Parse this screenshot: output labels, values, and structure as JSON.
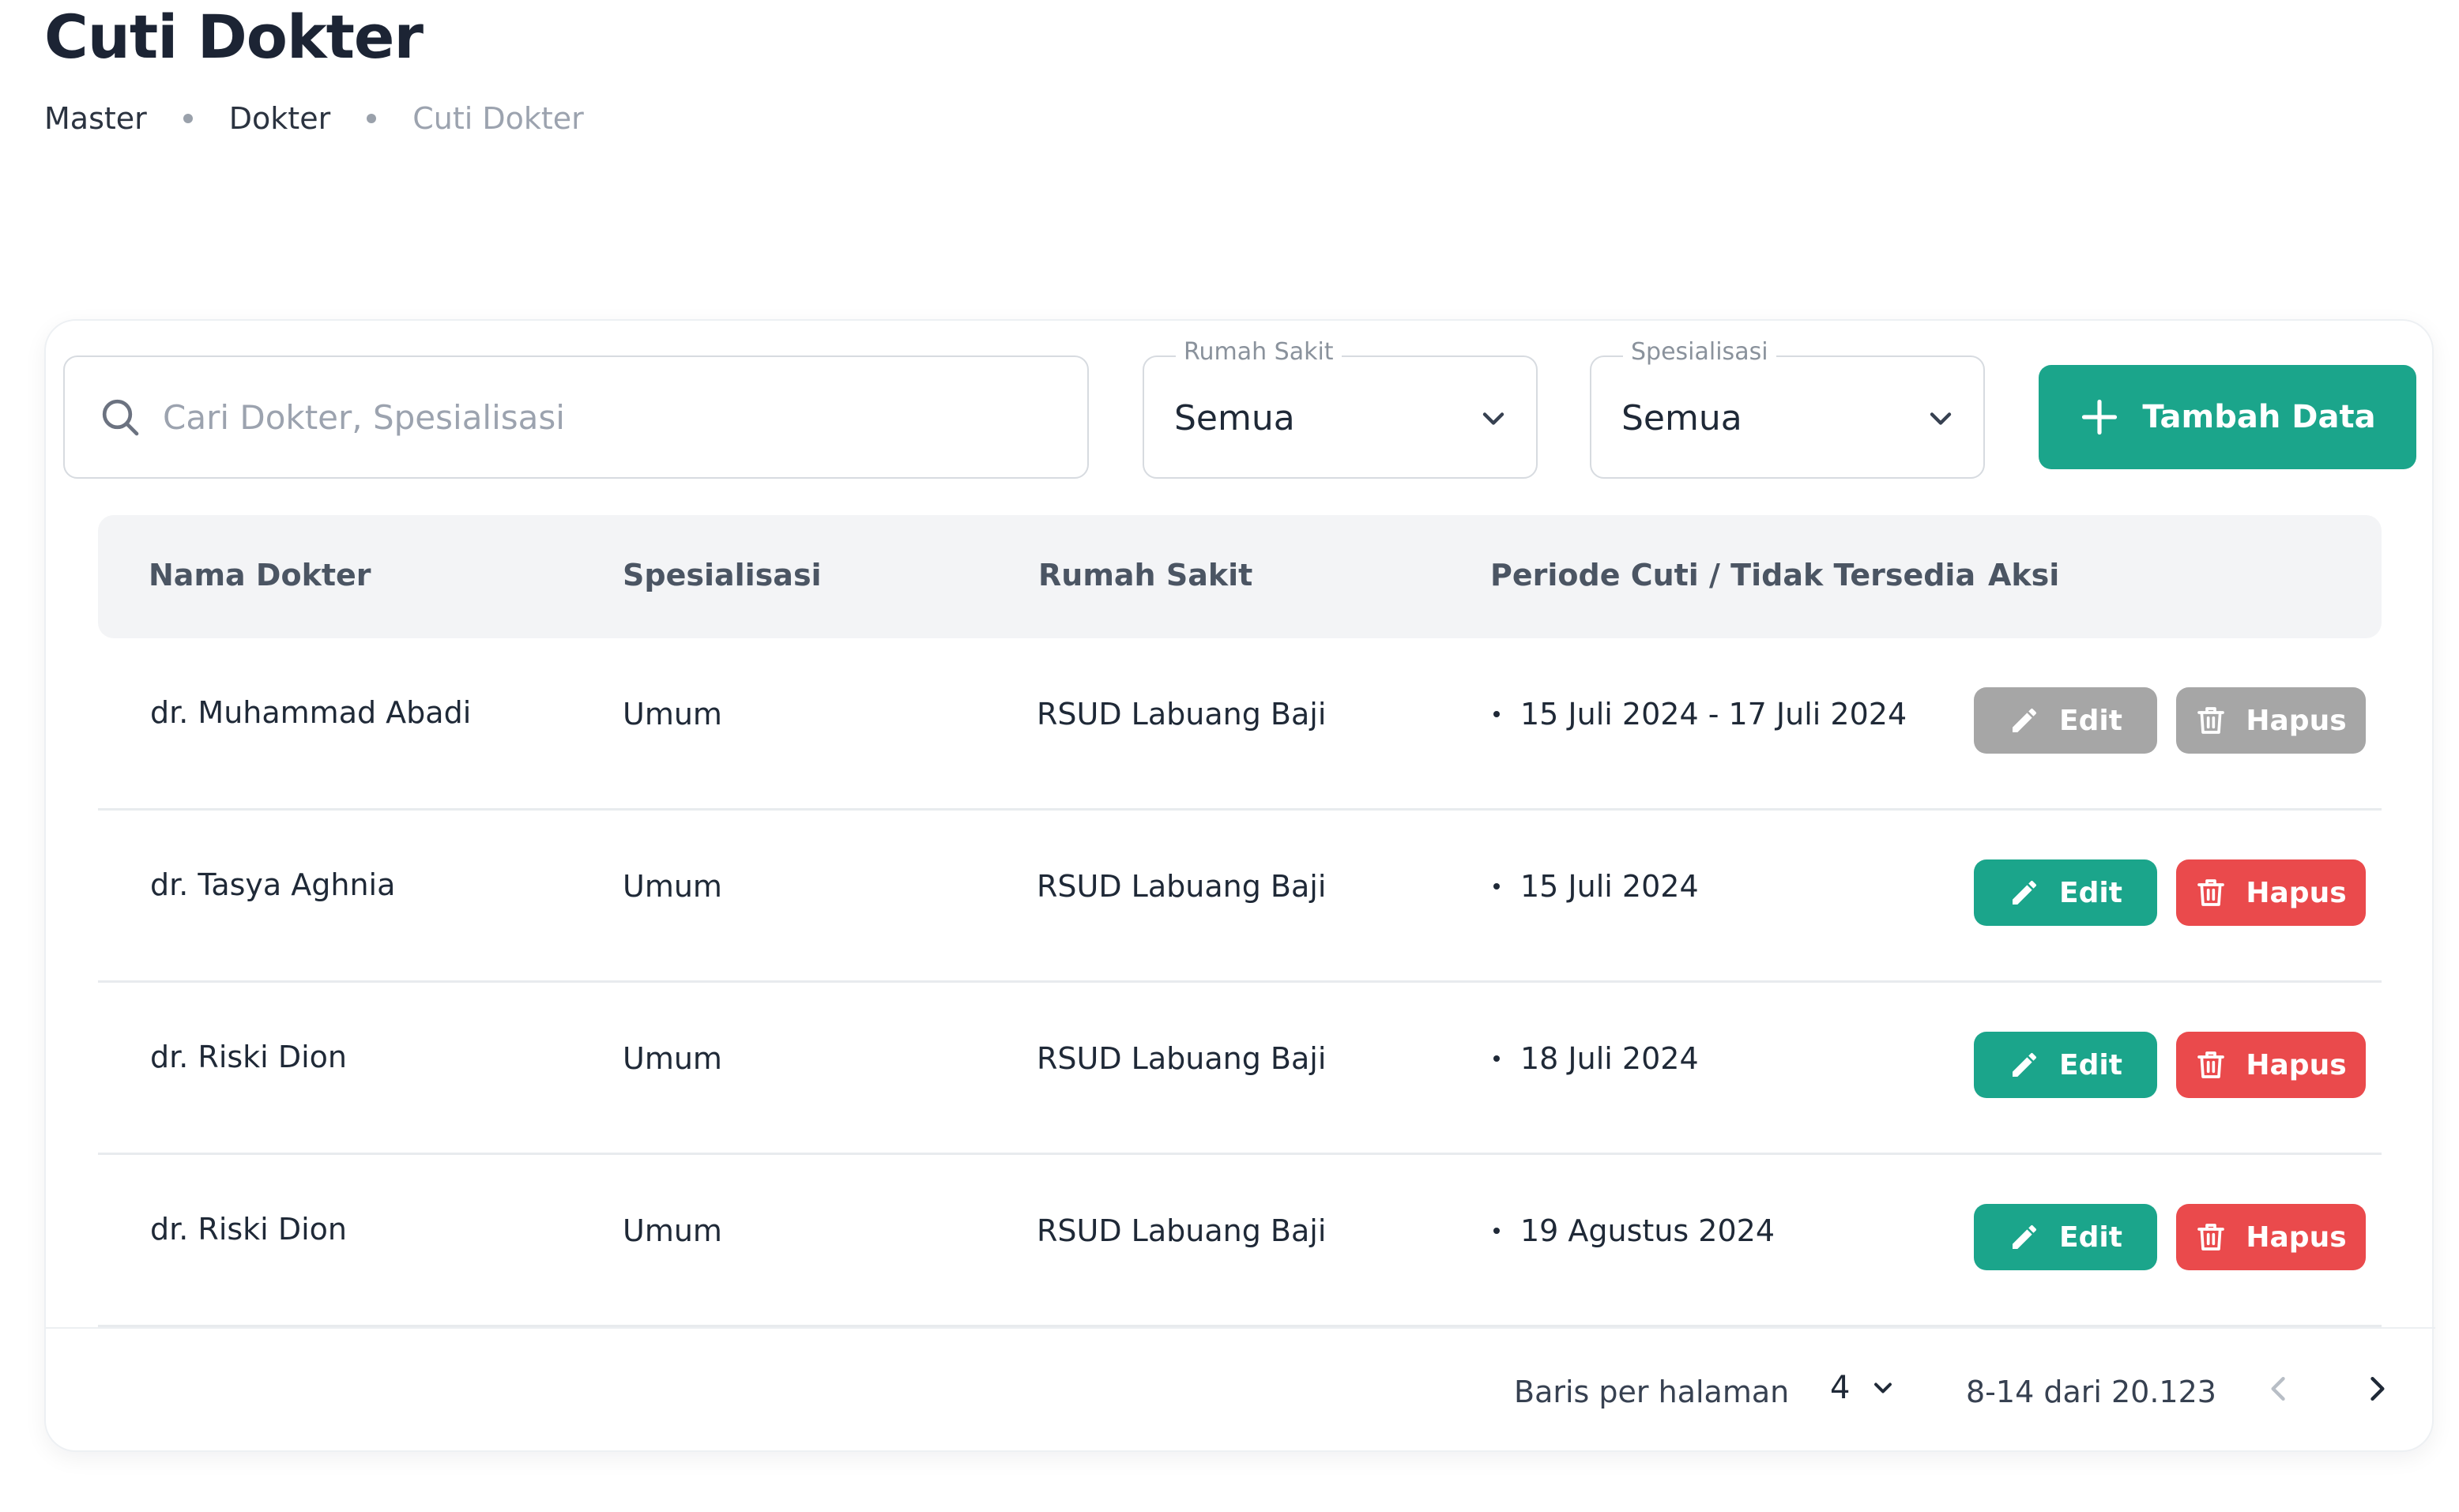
{
  "page": {
    "title": "Cuti Dokter",
    "breadcrumb": [
      "Master",
      "Dokter",
      "Cuti Dokter"
    ]
  },
  "toolbar": {
    "search_placeholder": "Cari Dokter, Spesialisasi",
    "hospital_filter": {
      "label": "Rumah Sakit",
      "value": "Semua"
    },
    "specialization_filter": {
      "label": "Spesialisasi",
      "value": "Semua"
    },
    "add_label": "Tambah Data"
  },
  "table": {
    "columns": [
      "Nama Dokter",
      "Spesialisasi",
      "Rumah Sakit",
      "Periode Cuti / Tidak Tersedia",
      "Aksi"
    ],
    "rows": [
      {
        "name": "dr. Muhammad Abadi",
        "specialization": "Umum",
        "hospital": "RSUD Labuang Baji",
        "period": "15 Juli 2024 - 17 Juli 2024",
        "edit": "Edit",
        "delete": "Hapus",
        "actions_enabled": false
      },
      {
        "name": "dr. Tasya Aghnia",
        "specialization": "Umum",
        "hospital": "RSUD Labuang Baji",
        "period": "15 Juli 2024",
        "edit": "Edit",
        "delete": "Hapus",
        "actions_enabled": true
      },
      {
        "name": "dr. Riski Dion",
        "specialization": "Umum",
        "hospital": "RSUD Labuang Baji",
        "period": "18 Juli 2024",
        "edit": "Edit",
        "delete": "Hapus",
        "actions_enabled": true
      },
      {
        "name": "dr. Riski Dion",
        "specialization": "Umum",
        "hospital": "RSUD Labuang Baji",
        "period": "19 Agustus 2024",
        "edit": "Edit",
        "delete": "Hapus",
        "actions_enabled": true
      }
    ]
  },
  "pagination": {
    "rows_per_page_label": "Baris per halaman",
    "rows_per_page": "4",
    "range": "8-14 dari 20.123"
  },
  "colors": {
    "primary": "#1ba58b",
    "danger": "#ea4a4c",
    "disabled": "#a6a6a6"
  },
  "icons": {
    "search": "search-icon",
    "dropdown": "chevron-down-icon",
    "add": "plus-icon",
    "edit": "pencil-icon",
    "delete": "trash-icon",
    "prev": "chevron-left-icon",
    "next": "chevron-right-icon"
  }
}
